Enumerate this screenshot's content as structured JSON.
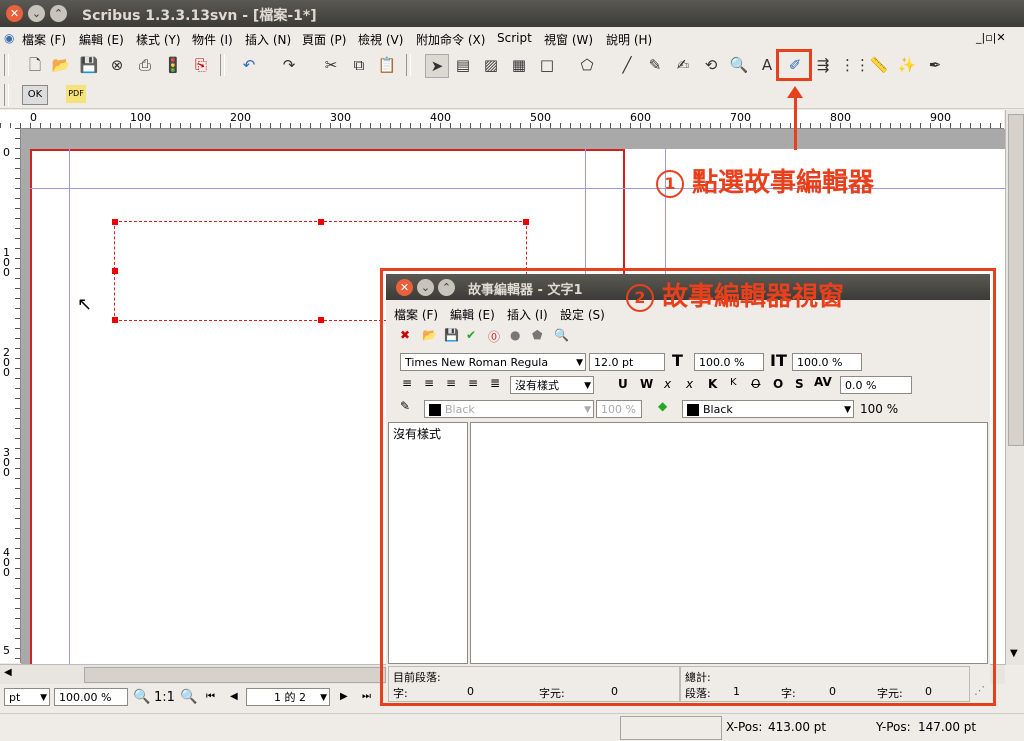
{
  "window": {
    "title": "Scribus 1.3.3.13svn - [檔案-1*]"
  },
  "menubar": {
    "items": [
      "檔案 (F)",
      "編輯 (E)",
      "樣式 (Y)",
      "物件 (I)",
      "插入 (N)",
      "頁面 (P)",
      "檢視 (V)",
      "附加命令 (X)",
      "Script",
      "視窗 (W)",
      "說明 (H)"
    ]
  },
  "toolbar2": {
    "ok_label": "OK",
    "pdf_label": "PDF"
  },
  "ruler": {
    "h_labels": [
      "0",
      "100",
      "200",
      "300",
      "400",
      "500",
      "600",
      "700",
      "800",
      "900"
    ],
    "v_labels": [
      "0",
      "1\n0\n0",
      "2\n0\n0",
      "3\n0\n0",
      "4\n0\n0",
      "5"
    ]
  },
  "annotations": {
    "step1_num": "1",
    "step1_text": "點選故事編輯器",
    "step2_num": "2",
    "step2_text": "故事編輯器視窗"
  },
  "story_editor": {
    "title": "故事編輯器 - 文字1",
    "menu": [
      "檔案 (F)",
      "編輯 (E)",
      "插入 (I)",
      "設定 (S)"
    ],
    "font": "Times New Roman Regula",
    "font_size": "12.0 pt",
    "scale_h": "100.0 %",
    "scale_v": "100.0 %",
    "paragraph_style": "沒有樣式",
    "format_buttons": [
      "U",
      "W",
      "x",
      "x",
      "K",
      "K",
      "O",
      "O",
      "S"
    ],
    "tracking": "0.0 %",
    "stroke_color": "Black",
    "stroke_shade": "100 %",
    "fill_color": "Black",
    "fill_shade": "100 %",
    "style_list_item": "沒有樣式",
    "status": {
      "current_para_label": "目前段落:",
      "words_label": "字:",
      "words_value": "0",
      "chars_label": "字元:",
      "chars_value": "0",
      "totals_label": "總計:",
      "paras_label": "段落:",
      "paras_value": "1",
      "t_words_label": "字:",
      "t_words_value": "0",
      "t_chars_label": "字元:",
      "t_chars_value": "0"
    }
  },
  "bottom": {
    "unit": "pt",
    "zoom": "100.00 %",
    "ratio": "1:1",
    "page_of": "1 的 2"
  },
  "statusbar": {
    "xpos_label": "X-Pos:",
    "xpos_value": "413.00 pt",
    "ypos_label": "Y-Pos:",
    "ypos_value": "147.00 pt"
  }
}
